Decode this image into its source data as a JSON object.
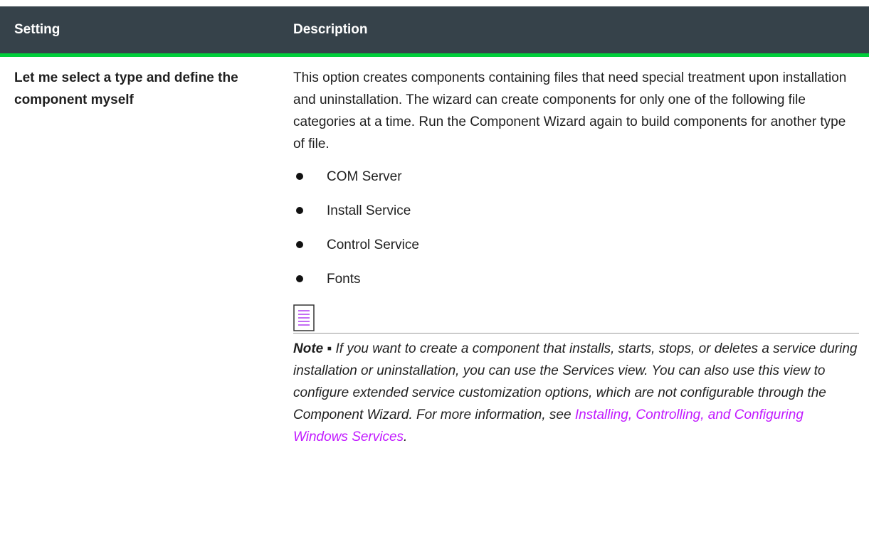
{
  "table": {
    "header": {
      "setting": "Setting",
      "description": "Description"
    },
    "row": {
      "setting": "Let me select a type and define the component myself",
      "description": "This option creates components containing files that need special treatment upon installation and uninstallation. The wizard can create components for only one of the following file categories at a time. Run the Component Wizard again to build components for another type of file.",
      "bullets": [
        "COM Server",
        "Install Service",
        "Control Service",
        "Fonts"
      ],
      "note": {
        "label": "Note ▪",
        "text": " If you want to create a component that installs, starts, stops, or deletes a service during installation or uninstallation, you can use the Services view. You can also use this view to configure extended service customization options, which are not configurable through the Component Wizard. For more information, see ",
        "link": "Installing, Controlling, and Configuring Windows Services",
        "end": "."
      }
    }
  },
  "colors": {
    "header_bg": "#36424a",
    "header_accent": "#00ce3a",
    "link": "#c119ff",
    "note_icon": "#b03cf0"
  },
  "icons": {
    "note": "note-page-icon",
    "bullet": "bullet-dot-icon"
  }
}
